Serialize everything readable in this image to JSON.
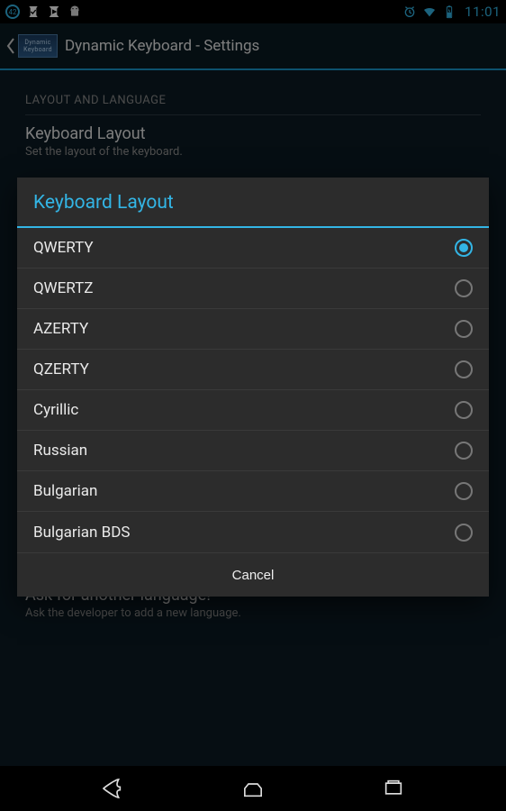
{
  "statusbar": {
    "badge": "42",
    "clock": "11:01"
  },
  "actionbar": {
    "app_icon_text1": "Dynamic",
    "app_icon_text2": "Keyboard",
    "title": "Dynamic Keyboard - Settings"
  },
  "settings": {
    "section1": "LAYOUT AND LANGUAGE",
    "layout": {
      "title": "Keyboard Layout",
      "summary": "Set the layout of the keyboard."
    },
    "ask": {
      "title": "Ask for another language!",
      "summary": "Ask the developer to add a new language."
    }
  },
  "dialog": {
    "title": "Keyboard Layout",
    "options": [
      {
        "label": "QWERTY",
        "selected": true
      },
      {
        "label": "QWERTZ",
        "selected": false
      },
      {
        "label": "AZERTY",
        "selected": false
      },
      {
        "label": "QZERTY",
        "selected": false
      },
      {
        "label": "Cyrillic",
        "selected": false
      },
      {
        "label": "Russian",
        "selected": false
      },
      {
        "label": "Bulgarian",
        "selected": false
      },
      {
        "label": "Bulgarian BDS",
        "selected": false
      }
    ],
    "cancel": "Cancel"
  }
}
